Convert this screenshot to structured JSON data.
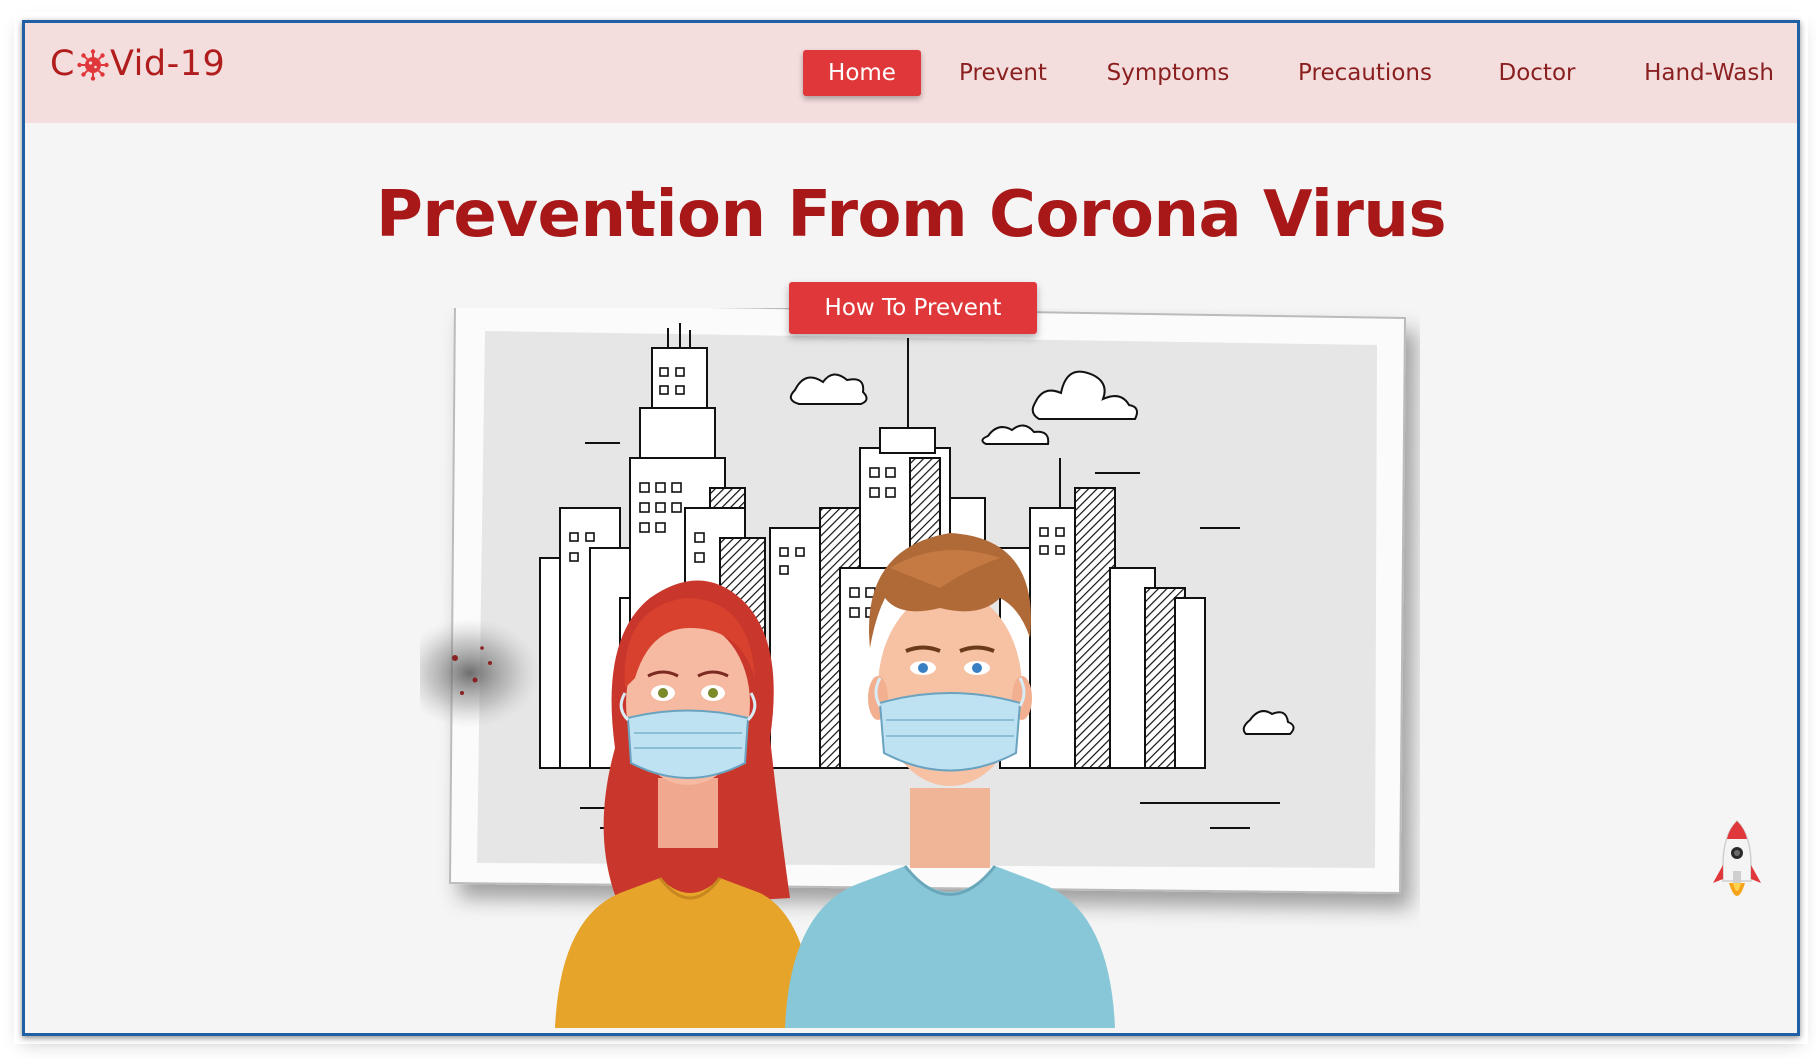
{
  "brand": {
    "prefix": "C",
    "suffix": "Vid-19",
    "accent_color": "#e0383a",
    "text_color": "#b11d1d",
    "virus_icon": "virus-icon"
  },
  "nav": {
    "items": [
      {
        "label": "Home",
        "active": true
      },
      {
        "label": "Prevent",
        "active": false
      },
      {
        "label": "Symptoms",
        "active": false
      },
      {
        "label": "Precautions",
        "active": false
      },
      {
        "label": "Doctor",
        "active": false
      },
      {
        "label": "Hand-Wash",
        "active": false
      }
    ],
    "background": "#f4dddd"
  },
  "hero": {
    "title": "Prevention From Corona Virus",
    "cta_label": "How To Prevent",
    "title_color": "#a81818"
  },
  "scroll_top": {
    "icon": "rocket-icon"
  }
}
